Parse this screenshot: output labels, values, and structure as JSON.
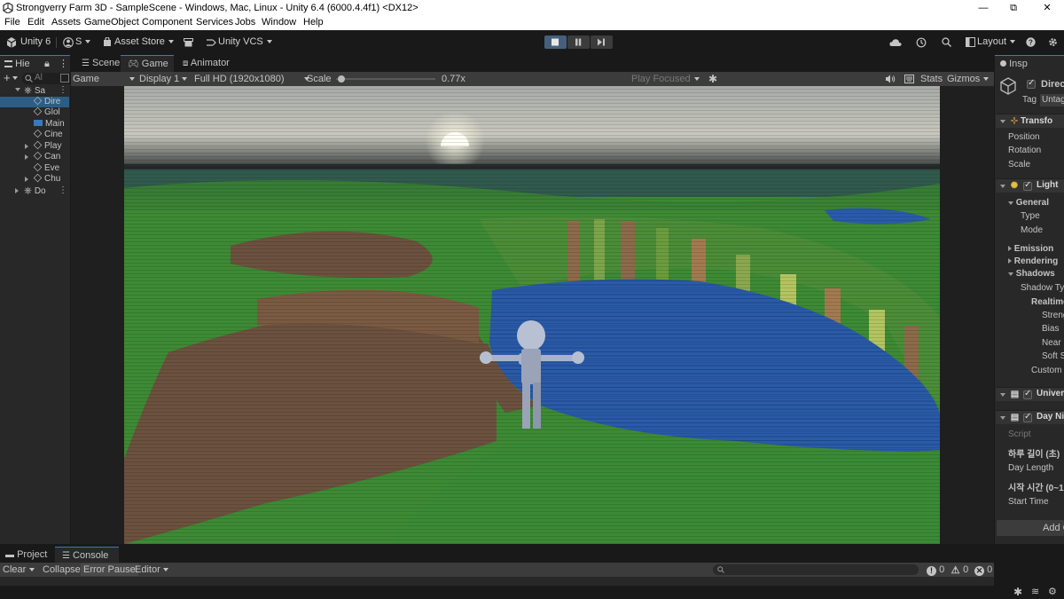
{
  "window": {
    "title": "Strongverry Farm 3D - SampleScene - Windows, Mac, Linux - Unity 6.4 (6000.4.4f1) <DX12>",
    "minimize": "—",
    "maximize": "⧉",
    "close": "✕"
  },
  "menu": [
    "File",
    "Edit",
    "Assets",
    "GameObject",
    "Component",
    "Services",
    "Jobs",
    "Window",
    "Help"
  ],
  "toolbar": {
    "unity_label": "Unity 6",
    "account_label": "S",
    "asset_store": "Asset Store",
    "vcs": "Unity VCS",
    "layout": "Layout"
  },
  "hierarchy": {
    "tab_label": "Hie",
    "search_placeholder": "Al",
    "rows": [
      {
        "label": "Sa",
        "kind": "scene",
        "expanded": true,
        "indent": 0
      },
      {
        "label": "Dire",
        "kind": "object",
        "indent": 1,
        "selected": true
      },
      {
        "label": "Glol",
        "kind": "object",
        "indent": 1
      },
      {
        "label": "Main",
        "kind": "camera",
        "indent": 1
      },
      {
        "label": "Cine",
        "kind": "object",
        "indent": 1
      },
      {
        "label": "Play",
        "kind": "object",
        "indent": 1,
        "collapsed": true
      },
      {
        "label": "Can",
        "kind": "object",
        "indent": 1,
        "collapsed": true
      },
      {
        "label": "Eve",
        "kind": "object",
        "indent": 1
      },
      {
        "label": "Chu",
        "kind": "object",
        "indent": 1,
        "collapsed": true
      },
      {
        "label": "Do",
        "kind": "scene",
        "collapsed": true,
        "indent": 0
      }
    ]
  },
  "center_tabs": {
    "scene": "Scene",
    "game": "Game",
    "animator": "Animator"
  },
  "game_controls": {
    "mode": "Game",
    "display": "Display 1",
    "resolution": "Full HD (1920x1080)",
    "scale_label": "Scale",
    "scale_value": "0.77x",
    "scale_fraction": 0.02,
    "play_focused": "Play Focused",
    "stats": "Stats",
    "gizmos": "Gizmos"
  },
  "inspector": {
    "tab_label": "Insp",
    "object_name": "Direc",
    "tag_label": "Tag",
    "tag_value": "Untag",
    "transform": {
      "header": "Transfo",
      "fields": [
        "Position",
        "Rotation",
        "Scale"
      ]
    },
    "light": {
      "header": "Light",
      "general": "General",
      "general_fields": [
        "Type",
        "Mode"
      ],
      "emission": "Emission",
      "rendering": "Rendering",
      "shadows": "Shadows",
      "shadow_type": "Shadow Ty",
      "realtime": "Realtime",
      "realtime_fields": [
        "Streng",
        "Bias",
        "Near",
        "Soft S"
      ],
      "custom": "Custom"
    },
    "universal": "Univers",
    "daynight": {
      "header": "Day Nig",
      "script_label": "Script",
      "day_length_korean": "하루 길이 (초)",
      "day_length": "Day Length",
      "start_time_korean": "시작 시간 (0~1",
      "start_time": "Start Time"
    },
    "add_component": "Add C"
  },
  "bottom": {
    "project_tab": "Project",
    "console_tab": "Console",
    "clear": "Clear",
    "collapse": "Collapse",
    "error_pause": "Error Pause",
    "editor": "Editor",
    "log_count": "0",
    "warn_count": "0",
    "error_count": "0"
  },
  "colors": {
    "accent": "#3a79bb",
    "selection": "#2c5d87",
    "panel": "#282828",
    "grass": "#3e8a35",
    "water": "#2a5ba8",
    "dirt": "#6b513e"
  }
}
